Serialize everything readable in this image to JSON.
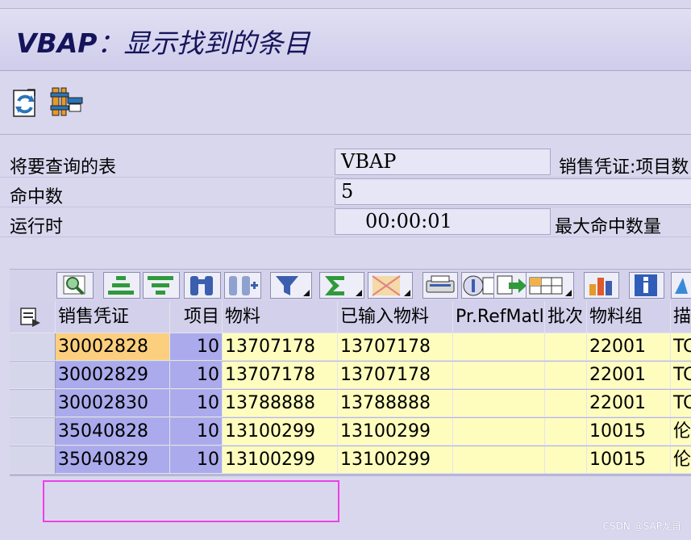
{
  "window": {
    "title_prefix": "VBAP",
    "title_suffix": "：显示找到的条目"
  },
  "app_toolbar": {
    "buttons": [
      {
        "name": "refresh-icon"
      },
      {
        "name": "settings-tools-icon"
      }
    ]
  },
  "header": {
    "table_label": "将要查询的表",
    "table_value": "VBAP",
    "table_desc": "销售凭证:项目数",
    "hits_label": "命中数",
    "hits_value": "5",
    "runtime_label": "运行时",
    "runtime_value": "00:00:01",
    "max_hits_label": "最大命中数量"
  },
  "alv_toolbar": {
    "buttons": [
      "details-icon",
      "sort-ascending-icon",
      "sort-descending-icon",
      "find-icon",
      "find-next-icon",
      "filter-icon",
      "sum-icon",
      "subtotals-icon",
      "print-preview-icon",
      "word-processing-icon",
      "export-icon",
      "change-layout-icon",
      "graphic-icon",
      "info-icon",
      "more-icon"
    ]
  },
  "grid": {
    "headers": [
      "销售凭证",
      "项目",
      "物料",
      "已输入物料",
      "Pr.RefMatl",
      "批次",
      "物料组",
      "描"
    ],
    "rows": [
      {
        "doc": "30002828",
        "item": "10",
        "material": "13707178",
        "entered": "13707178",
        "prref": "",
        "batch": "",
        "matgroup": "22001",
        "desc": "TC"
      },
      {
        "doc": "30002829",
        "item": "10",
        "material": "13707178",
        "entered": "13707178",
        "prref": "",
        "batch": "",
        "matgroup": "22001",
        "desc": "TC"
      },
      {
        "doc": "30002830",
        "item": "10",
        "material": "13788888",
        "entered": "13788888",
        "prref": "",
        "batch": "",
        "matgroup": "22001",
        "desc": "TC"
      },
      {
        "doc": "35040828",
        "item": "10",
        "material": "13100299",
        "entered": "13100299",
        "prref": "",
        "batch": "",
        "matgroup": "10015",
        "desc": "伦"
      },
      {
        "doc": "35040829",
        "item": "10",
        "material": "13100299",
        "entered": "13100299",
        "prref": "",
        "batch": "",
        "matgroup": "10015",
        "desc": "伦"
      }
    ]
  },
  "watermark": "CSDN @SAP龙哥",
  "colors": {
    "key_column": "#aaaaec",
    "active_cell": "#fbcf7e",
    "data_cell": "#fefdbe",
    "highlight_box": "#ee3fe6"
  }
}
